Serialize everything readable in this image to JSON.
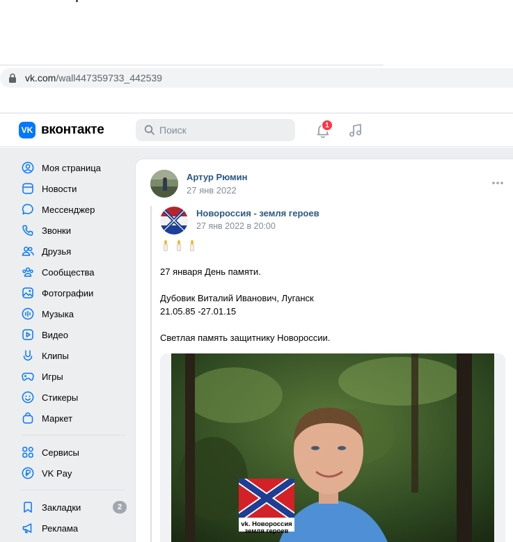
{
  "browser": {
    "url_host": "vk.com",
    "url_path": "/wall447359733_442539"
  },
  "header": {
    "logo_mark": "VK",
    "logo_text": "вконтакте",
    "search_placeholder": "Поиск",
    "notifications_count": "1"
  },
  "sidebar": {
    "items": [
      {
        "label": "Моя страница",
        "icon": "user-circle-icon"
      },
      {
        "label": "Новости",
        "icon": "newspaper-icon"
      },
      {
        "label": "Мессенджер",
        "icon": "chat-bubble-icon"
      },
      {
        "label": "Звонки",
        "icon": "phone-icon"
      },
      {
        "label": "Друзья",
        "icon": "friends-icon"
      },
      {
        "label": "Сообщества",
        "icon": "community-icon"
      },
      {
        "label": "Фотографии",
        "icon": "photo-icon"
      },
      {
        "label": "Музыка",
        "icon": "music-wave-icon"
      },
      {
        "label": "Видео",
        "icon": "video-icon"
      },
      {
        "label": "Клипы",
        "icon": "clips-icon"
      },
      {
        "label": "Игры",
        "icon": "gamepad-icon"
      },
      {
        "label": "Стикеры",
        "icon": "smile-icon"
      },
      {
        "label": "Маркет",
        "icon": "bag-icon"
      }
    ],
    "services": [
      {
        "label": "Сервисы",
        "icon": "services-icon"
      },
      {
        "label": "VK Pay",
        "icon": "vkpay-icon"
      }
    ],
    "extra": [
      {
        "label": "Закладки",
        "icon": "bookmark-icon",
        "count": "2"
      },
      {
        "label": "Реклама",
        "icon": "megaphone-icon"
      }
    ]
  },
  "post": {
    "author": "Артур Рюмин",
    "date": "27 янв 2022",
    "repost": {
      "group_name": "Новороссия - земля героев",
      "date": "27 янв 2022 в 20:00",
      "lines": [
        "27 января День памяти.",
        "Дубовик Виталий Иванович, Луганск",
        "21.05.85 -27.01.15",
        "Светлая память защитнику Новороссии."
      ],
      "watermark_line1": "vk. Новороссия",
      "watermark_line2": "земля героев"
    }
  },
  "colors": {
    "vk_blue": "#0077ff",
    "link": "#2a5885",
    "secondary_text": "#818c99",
    "badge_red": "#ff3347",
    "background": "#edeef0"
  }
}
